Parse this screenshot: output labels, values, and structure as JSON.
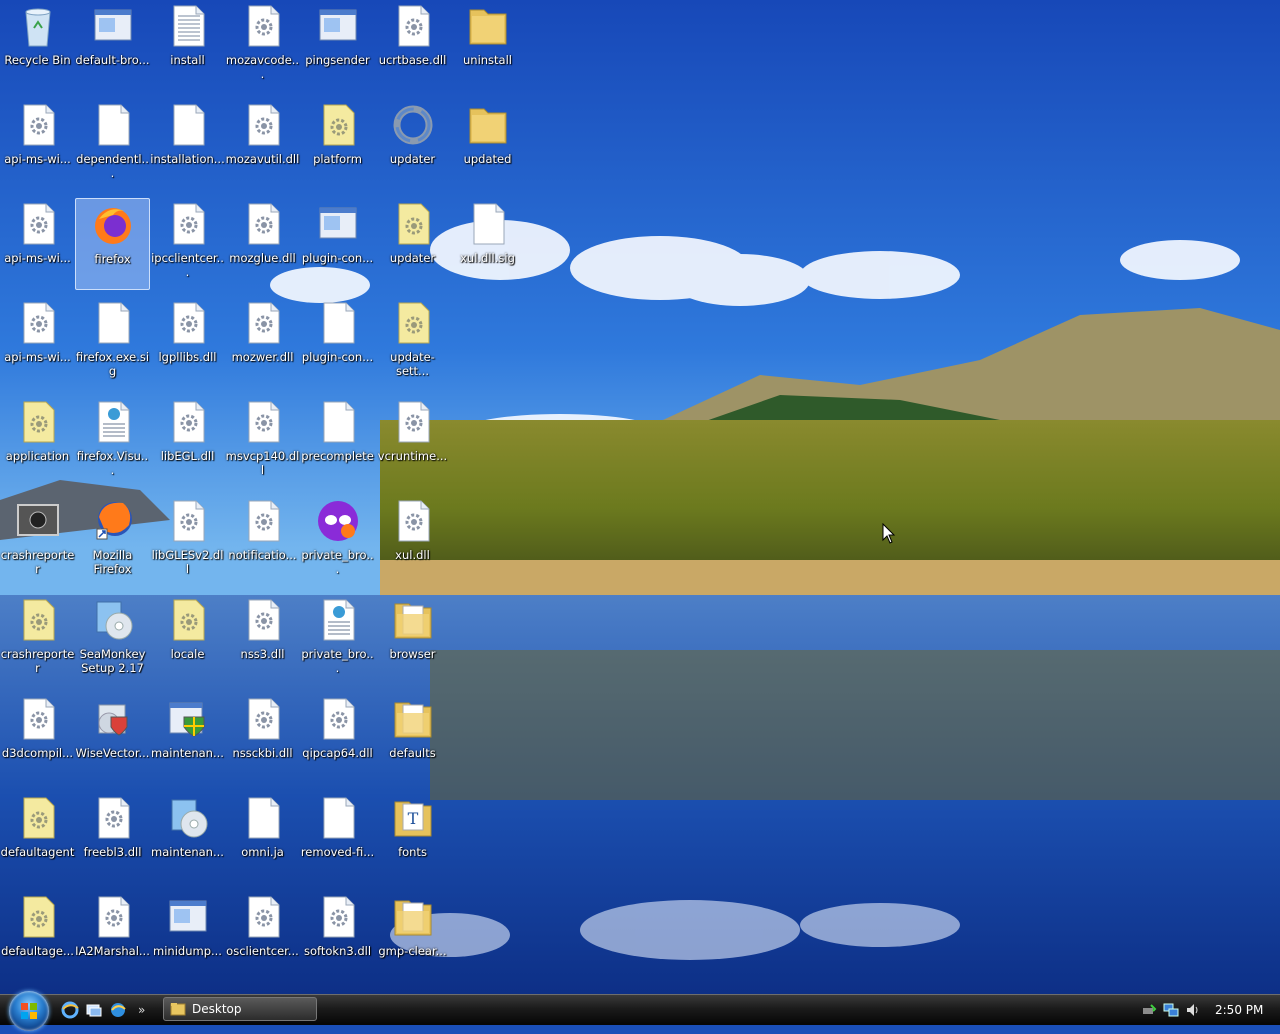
{
  "desktop": {
    "icons": [
      {
        "label": "Recycle Bin",
        "type": "recycle"
      },
      {
        "label": "default-bro...",
        "type": "window"
      },
      {
        "label": "install",
        "type": "text"
      },
      {
        "label": "mozavcode...",
        "type": "dll"
      },
      {
        "label": "pingsender",
        "type": "window"
      },
      {
        "label": "ucrtbase.dll",
        "type": "dll"
      },
      {
        "label": "uninstall",
        "type": "folder"
      },
      {
        "label": "api-ms-wi...",
        "type": "dll"
      },
      {
        "label": "dependentl...",
        "type": "blank"
      },
      {
        "label": "installation...",
        "type": "blank"
      },
      {
        "label": "mozavutil.dll",
        "type": "dll"
      },
      {
        "label": "platform",
        "type": "config"
      },
      {
        "label": "updater",
        "type": "updater"
      },
      {
        "label": "updated",
        "type": "folder"
      },
      {
        "label": "api-ms-wi...",
        "type": "dll"
      },
      {
        "label": "firefox",
        "type": "firefox",
        "selected": true
      },
      {
        "label": "ipcclientcer...",
        "type": "dll"
      },
      {
        "label": "mozglue.dll",
        "type": "dll"
      },
      {
        "label": "plugin-con...",
        "type": "window"
      },
      {
        "label": "updater",
        "type": "config"
      },
      {
        "label": "xul.dll.sig",
        "type": "blank"
      },
      {
        "label": "api-ms-wi...",
        "type": "dll"
      },
      {
        "label": "firefox.exe.sig",
        "type": "blank"
      },
      {
        "label": "lgpllibs.dll",
        "type": "dll"
      },
      {
        "label": "mozwer.dll",
        "type": "dll"
      },
      {
        "label": "plugin-con...",
        "type": "blank"
      },
      {
        "label": "update-sett...",
        "type": "config"
      },
      {
        "label": "application",
        "type": "config"
      },
      {
        "label": "firefox.Visu...",
        "type": "manifest"
      },
      {
        "label": "libEGL.dll",
        "type": "dll"
      },
      {
        "label": "msvcp140.dll",
        "type": "dll"
      },
      {
        "label": "precomplete",
        "type": "blank"
      },
      {
        "label": "vcruntime...",
        "type": "dll"
      },
      {
        "label": "crashreporter",
        "type": "crash"
      },
      {
        "label": "Mozilla Firefox",
        "type": "firefox-shortcut"
      },
      {
        "label": "libGLESv2.dll",
        "type": "dll"
      },
      {
        "label": "notificatio...",
        "type": "dll"
      },
      {
        "label": "private_bro...",
        "type": "private"
      },
      {
        "label": "xul.dll",
        "type": "dll"
      },
      {
        "label": "crashreporter",
        "type": "config"
      },
      {
        "label": "SeaMonkey Setup 2.17",
        "type": "setup"
      },
      {
        "label": "locale",
        "type": "config"
      },
      {
        "label": "nss3.dll",
        "type": "dll"
      },
      {
        "label": "private_bro...",
        "type": "manifest"
      },
      {
        "label": "browser",
        "type": "folder-doc"
      },
      {
        "label": "d3dcompil...",
        "type": "dll"
      },
      {
        "label": "WiseVector...",
        "type": "setup2"
      },
      {
        "label": "maintenan...",
        "type": "shield-window"
      },
      {
        "label": "nssckbi.dll",
        "type": "dll"
      },
      {
        "label": "qipcap64.dll",
        "type": "dll"
      },
      {
        "label": "defaults",
        "type": "folder-doc"
      },
      {
        "label": "defaultagent",
        "type": "config"
      },
      {
        "label": "freebl3.dll",
        "type": "dll"
      },
      {
        "label": "maintenan...",
        "type": "setup"
      },
      {
        "label": "omni.ja",
        "type": "blank"
      },
      {
        "label": "removed-fi...",
        "type": "blank"
      },
      {
        "label": "fonts",
        "type": "fonts"
      },
      {
        "label": "defaultage...",
        "type": "config"
      },
      {
        "label": "IA2Marshal...",
        "type": "dll"
      },
      {
        "label": "minidump...",
        "type": "window"
      },
      {
        "label": "osclientcer...",
        "type": "dll"
      },
      {
        "label": "softokn3.dll",
        "type": "dll"
      },
      {
        "label": "gmp-clear...",
        "type": "folder-doc"
      }
    ]
  },
  "taskbar": {
    "start_icon": "windows-start-orb-icon",
    "quick_launch": [
      "ie-icon",
      "show-desktop-icon",
      "switch-windows-icon"
    ],
    "more": "»",
    "task_label": "Desktop",
    "clock": "2:50 PM"
  },
  "colors": {
    "sky_top": "#1f55c4",
    "sky_mid": "#3b8ee6",
    "water": "#1a47a8"
  }
}
